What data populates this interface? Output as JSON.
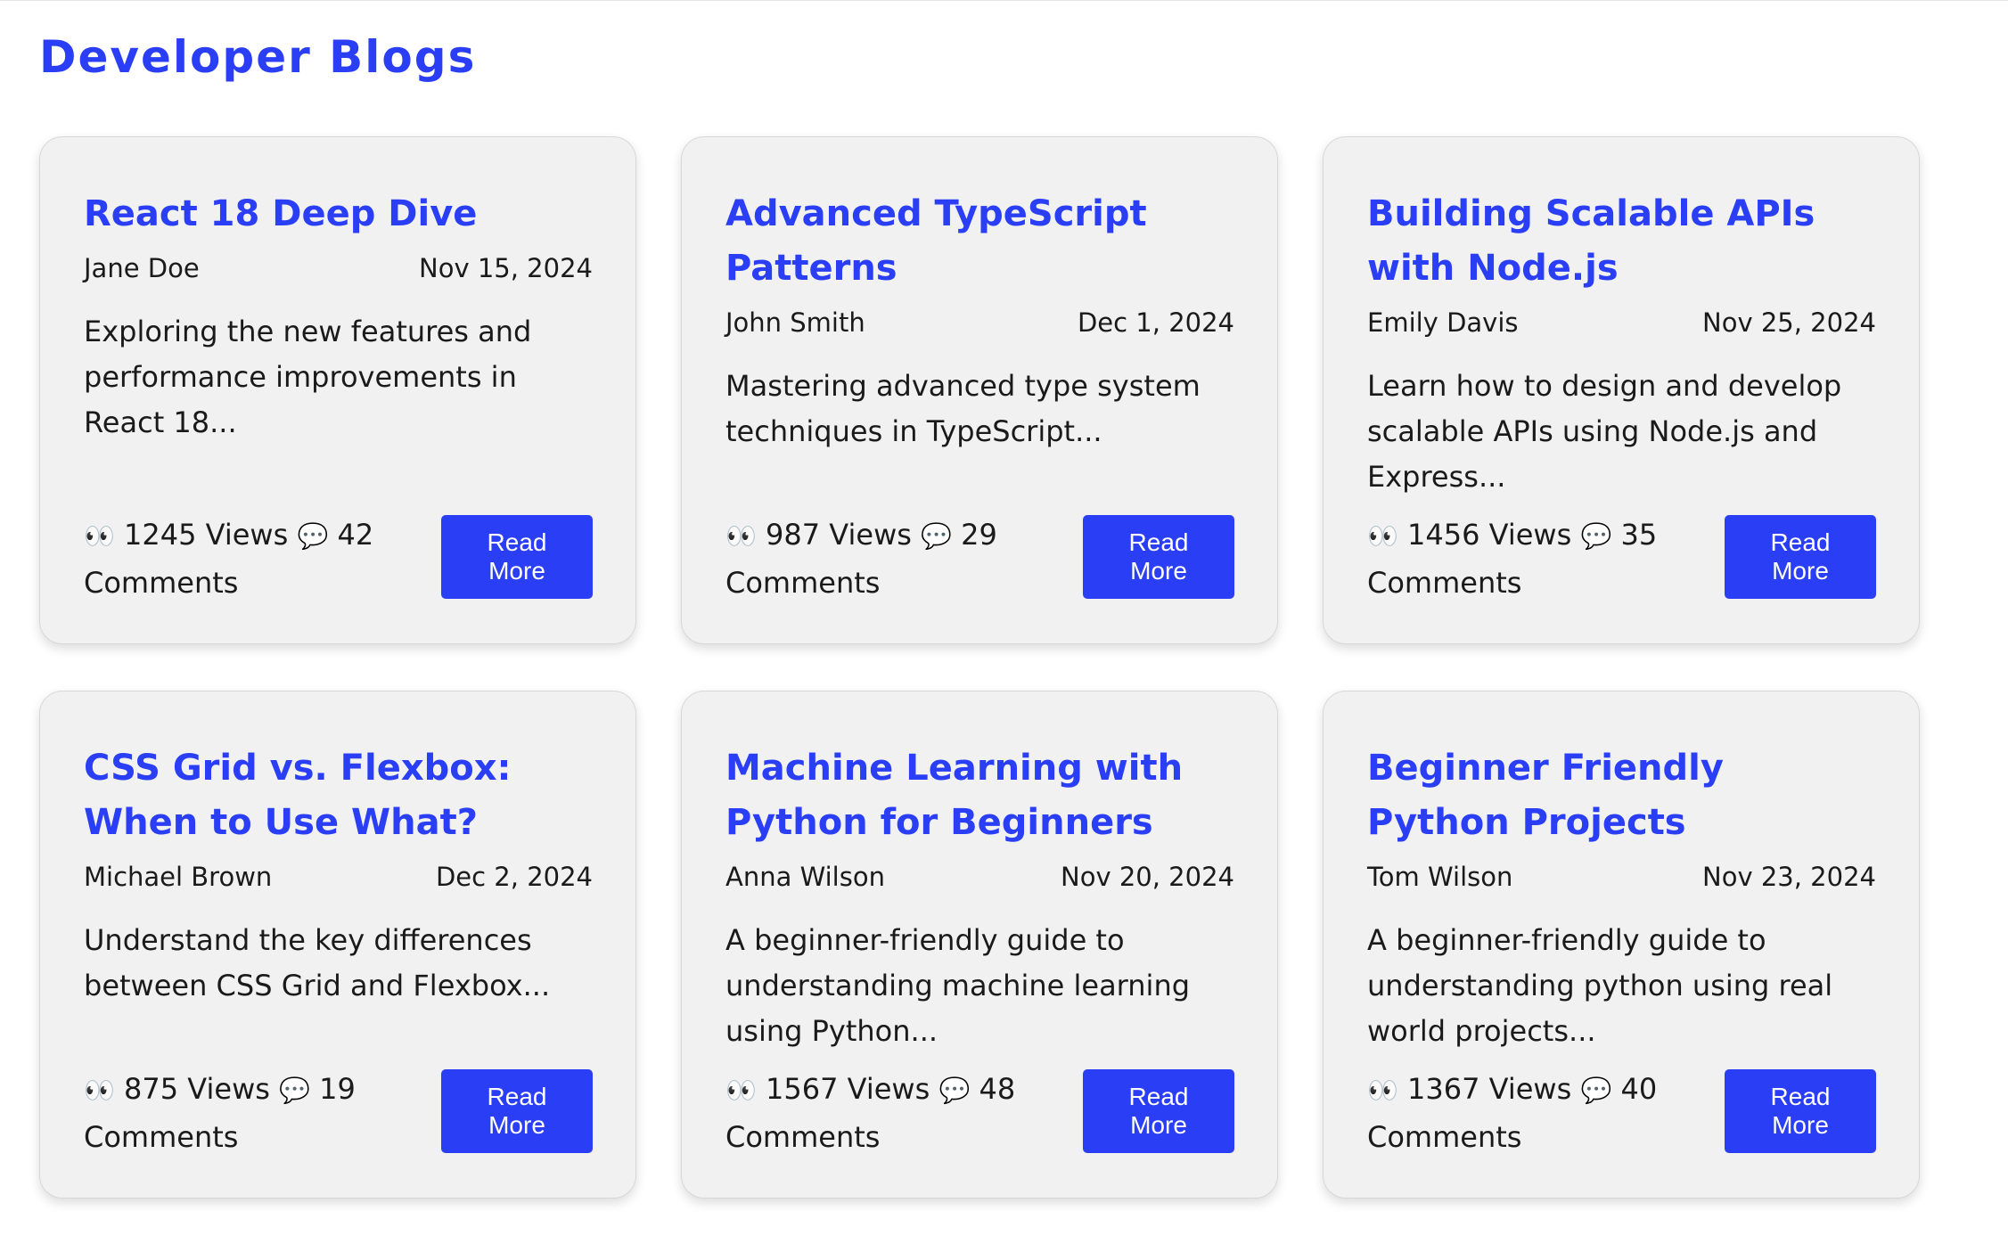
{
  "header": {
    "title": "Developer Blogs"
  },
  "stats_labels": {
    "views": "Views",
    "comments": "Comments",
    "views_icon": "eyes-icon",
    "comments_icon": "speech-bubble-icon"
  },
  "read_more_label": "Read More",
  "colors": {
    "accent": "#2a3ef5",
    "card_background": "#f1f1f1"
  },
  "posts": [
    {
      "title": "React 18 Deep Dive",
      "author": "Jane Doe",
      "date": "Nov 15, 2024",
      "excerpt": "Exploring the new features and performance improvements in React 18...",
      "views": "1245",
      "comments": "42"
    },
    {
      "title": "Advanced TypeScript Patterns",
      "author": "John Smith",
      "date": "Dec 1, 2024",
      "excerpt": "Mastering advanced type system techniques in TypeScript...",
      "views": "987",
      "comments": "29"
    },
    {
      "title": "Building Scalable APIs with Node.js",
      "author": "Emily Davis",
      "date": "Nov 25, 2024",
      "excerpt": "Learn how to design and develop scalable APIs using Node.js and Express...",
      "views": "1456",
      "comments": "35"
    },
    {
      "title": "CSS Grid vs. Flexbox: When to Use What?",
      "author": "Michael Brown",
      "date": "Dec 2, 2024",
      "excerpt": "Understand the key differences between CSS Grid and Flexbox...",
      "views": "875",
      "comments": "19"
    },
    {
      "title": "Machine Learning with Python for Beginners",
      "author": "Anna Wilson",
      "date": "Nov 20, 2024",
      "excerpt": "A beginner-friendly guide to understanding machine learning using Python...",
      "views": "1567",
      "comments": "48"
    },
    {
      "title": "Beginner Friendly Python Projects",
      "author": "Tom Wilson",
      "date": "Nov 23, 2024",
      "excerpt": "A beginner-friendly guide to understanding python using real world projects...",
      "views": "1367",
      "comments": "40"
    }
  ]
}
